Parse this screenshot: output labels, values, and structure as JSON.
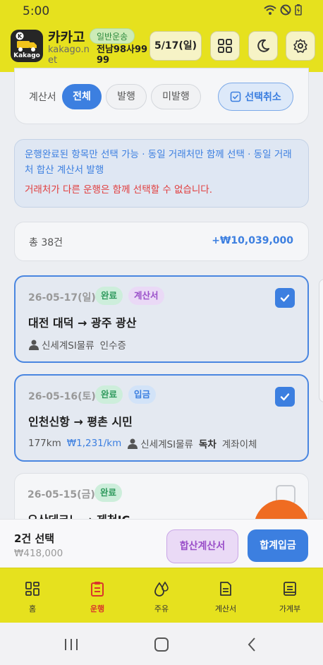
{
  "status_bar": {
    "time": "5:00"
  },
  "app_bar": {
    "logo_text": "Kakago",
    "brand": "카카고",
    "domain": "kakago.net",
    "mode_badge": "일반운송",
    "plate": "전남98사9999",
    "date": "5/17(일)"
  },
  "filter": {
    "label": "계산서",
    "chips": [
      "전체",
      "발행",
      "미발행"
    ],
    "active_chip": "전체",
    "cancel_selection": "선택취소"
  },
  "notice": {
    "info": "운행완료된 항목만 선택 가능 · 동일 거래처만 함께 선택 · 동일 거래처 합산 계산서 발행",
    "warning": "거래처가 다른 운행은 함께 선택할 수 없습니다."
  },
  "summary": {
    "count": "총 38건",
    "total": "+₩10,039,000"
  },
  "trips": [
    {
      "date": "26-05-17(일)",
      "badges": [
        "완료",
        "계산서"
      ],
      "route": "대전 대덕 → 광주 광산",
      "distance": "",
      "unit_price": "",
      "client": "신세계SI물류",
      "extra1": "인수증",
      "extra2": "",
      "selected": true
    },
    {
      "date": "26-05-16(토)",
      "badges": [
        "완료",
        "입금"
      ],
      "route": "인천신항 → 평촌 시민",
      "distance": "177km",
      "unit_price": "₩1,231/km",
      "client": "신세계SI물류",
      "extra1": "독차",
      "extra2": "계좌이체",
      "selected": true
    },
    {
      "date": "26-05-15(금)",
      "badges": [
        "완료"
      ],
      "route": "오산데크노 → 제천IC",
      "selected": false
    }
  ],
  "selection_bar": {
    "count": "2건 선택",
    "amount": "₩418,000",
    "merge_invoice": "합산계산서",
    "merge_deposit": "합계입금"
  },
  "bottom_nav": {
    "items": [
      "홈",
      "운행",
      "주유",
      "계산서",
      "가계부"
    ],
    "active": "운행"
  },
  "colors": {
    "brand_yellow": "#e6e11e",
    "accent_blue": "#3c7fe0",
    "warning_red": "#e13d3d",
    "active_nav_red": "#d9362b",
    "fab_orange": "#ef6c22"
  }
}
